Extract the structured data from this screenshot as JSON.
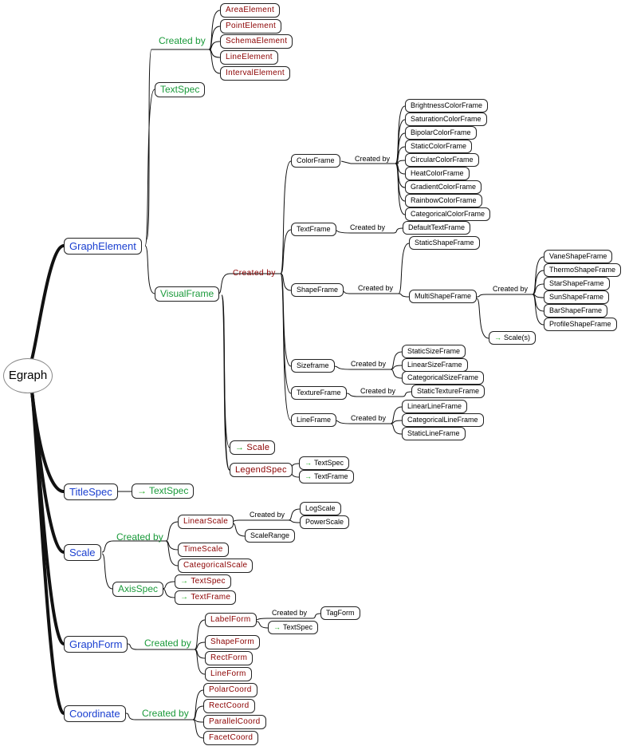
{
  "root": "Egraph",
  "connector_label": "Created by",
  "colors": {
    "level1_text": "#1a3fd0",
    "green_text": "#1a9a3a",
    "red_text": "#8b0000",
    "arrow": "#22aa22"
  },
  "graph_element": {
    "label": "GraphElement",
    "created_by": [
      "AreaElement",
      "PointElement",
      "SchemaElement",
      "LineElement",
      "IntervalElement"
    ],
    "text_spec": "TextSpec",
    "visual_frame": {
      "label": "VisualFrame",
      "color_frame": {
        "label": "ColorFrame",
        "created_by": [
          "BrightnessColorFrame",
          "SaturationColorFrame",
          "BipolarColorFrame",
          "StaticColorFrame",
          "CircularColorFrame",
          "HeatColorFrame",
          "GradientColorFrame",
          "RainbowColorFrame",
          "CategoricalColorFrame"
        ]
      },
      "text_frame": {
        "label": "TextFrame",
        "created_by": [
          "DefaultTextFrame"
        ]
      },
      "shape_frame": {
        "label": "ShapeFrame",
        "static": "StaticShapeFrame",
        "multi": {
          "label": "MultiShapeFrame",
          "created_by": [
            "VaneShapeFrame",
            "ThermoShapeFrame",
            "StarShapeFrame",
            "SunShapeFrame",
            "BarShapeFrame",
            "ProfileShapeFrame"
          ],
          "scale_ref": "Scale(s)"
        }
      },
      "size_frame": {
        "label": "Sizeframe",
        "created_by": [
          "StaticSizeFrame",
          "LinearSizeFrame",
          "CategoricalSizeFrame"
        ]
      },
      "texture_frame": {
        "label": "TextureFrame",
        "created_by": [
          "StaticTextureFrame"
        ]
      },
      "line_frame": {
        "label": "LineFrame",
        "created_by": [
          "LinearLineFrame",
          "CategoricalLineFrame",
          "StaticLineFrame"
        ]
      },
      "scale_ref": "Scale",
      "legend_spec": {
        "label": "LegendSpec",
        "refs": [
          "TextSpec",
          "TextFrame"
        ]
      }
    }
  },
  "title_spec": {
    "label": "TitleSpec",
    "ref": "TextSpec"
  },
  "scale": {
    "label": "Scale",
    "created_by": {
      "linear": {
        "label": "LinearScale",
        "created_by": [
          "LogScale",
          "PowerScale"
        ],
        "range": "ScaleRange"
      },
      "time": "TimeScale",
      "categorical": "CategoricalScale"
    },
    "axis_spec": {
      "label": "AxisSpec",
      "refs": [
        "TextSpec",
        "TextFrame"
      ]
    }
  },
  "graph_form": {
    "label": "GraphForm",
    "label_form": {
      "label": "LabelForm",
      "created_by": [
        "TagForm"
      ],
      "ref": "TextSpec"
    },
    "others": [
      "ShapeForm",
      "RectForm",
      "LineForm"
    ]
  },
  "coordinate": {
    "label": "Coordinate",
    "created_by": [
      "PolarCoord",
      "RectCoord",
      "ParallelCoord",
      "FacetCoord"
    ]
  },
  "arrow_glyph": "→"
}
